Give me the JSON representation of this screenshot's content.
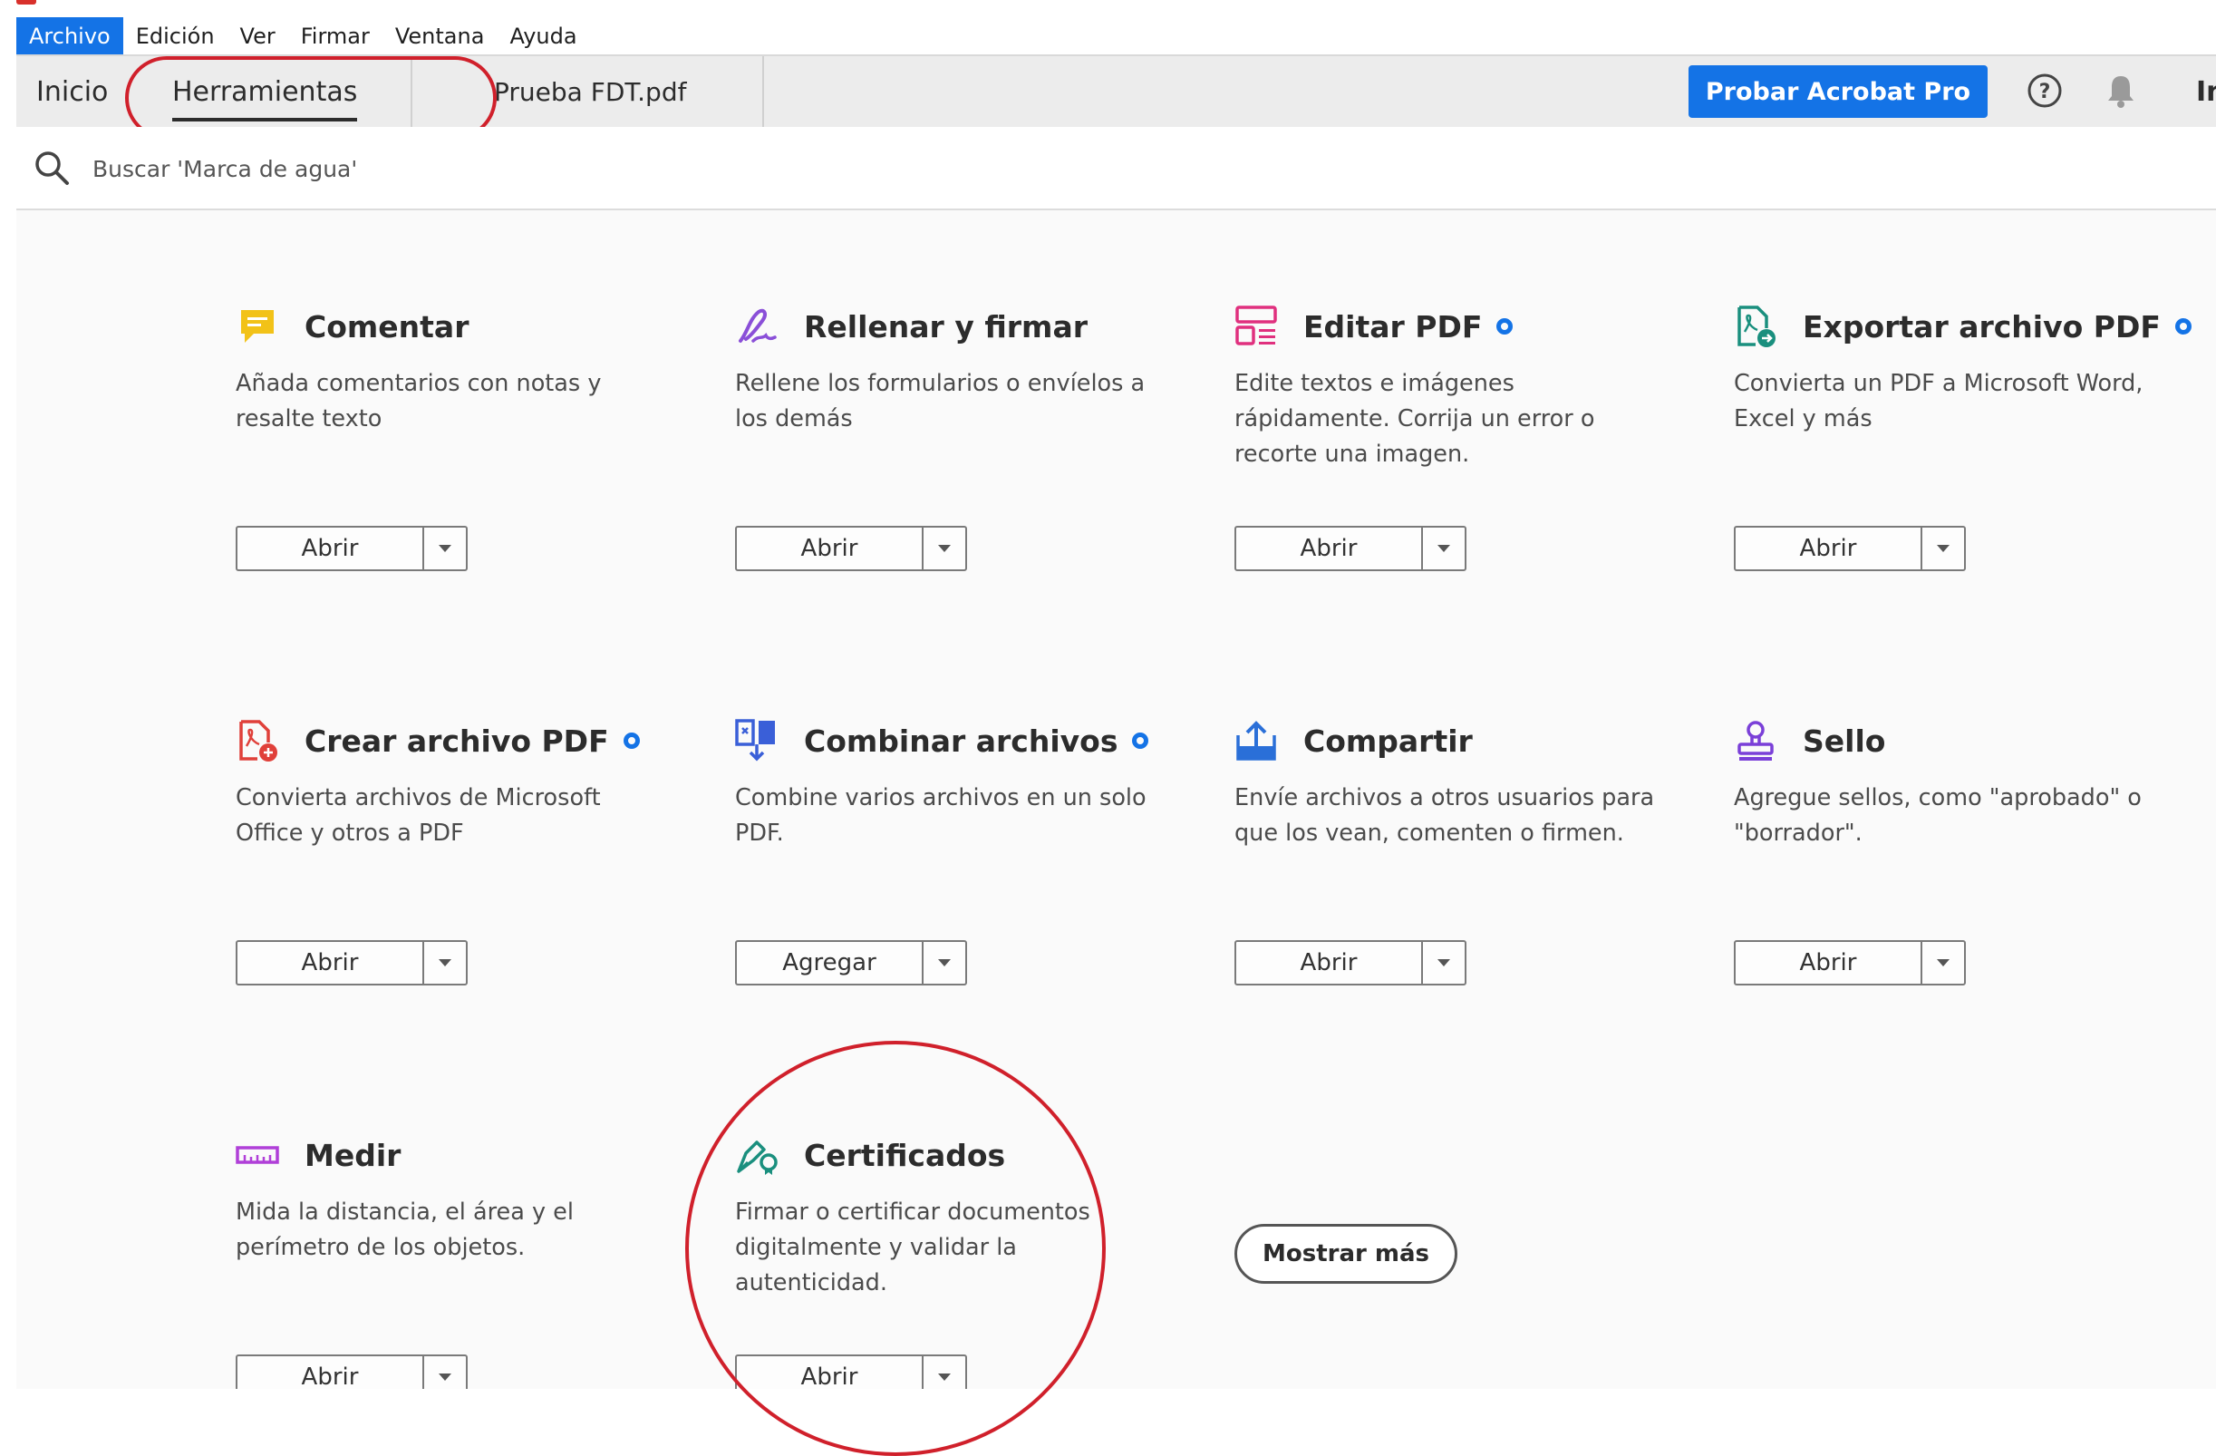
{
  "menu": [
    "Archivo",
    "Edición",
    "Ver",
    "Firmar",
    "Ventana",
    "Ayuda"
  ],
  "tabs": {
    "home": "Inicio",
    "tools": "Herramientas",
    "file": "Prueba FDT.pdf",
    "signin": "Ini"
  },
  "header": {
    "pro_button": "Probar Acrobat Pro"
  },
  "search": {
    "placeholder": "Buscar 'Marca de agua'"
  },
  "tools": [
    {
      "title": "Comentar",
      "desc": "Añada comentarios con notas y resalte texto",
      "button": "Abrir",
      "pro": false,
      "icon": "comment-icon"
    },
    {
      "title": "Rellenar y firmar",
      "desc": "Rellene los formularios o envíelos a los demás",
      "button": "Abrir",
      "pro": false,
      "icon": "fill-sign-icon"
    },
    {
      "title": "Editar PDF",
      "desc": "Edite textos e imágenes rápidamente. Corrija un error o recorte una imagen.",
      "button": "Abrir",
      "pro": true,
      "icon": "edit-pdf-icon"
    },
    {
      "title": "Exportar archivo PDF",
      "desc": "Convierta un PDF a Microsoft Word, Excel y más",
      "button": "Abrir",
      "pro": true,
      "icon": "export-pdf-icon"
    },
    {
      "title": "Crear archivo PDF",
      "desc": "Convierta archivos de Microsoft Office y otros a PDF",
      "button": "Abrir",
      "pro": true,
      "icon": "create-pdf-icon"
    },
    {
      "title": "Combinar archivos",
      "desc": "Combine varios archivos en un solo PDF.",
      "button": "Agregar",
      "pro": true,
      "icon": "combine-files-icon"
    },
    {
      "title": "Compartir",
      "desc": "Envíe archivos a otros usuarios para que los vean, comenten o firmen.",
      "button": "Abrir",
      "pro": false,
      "icon": "share-icon"
    },
    {
      "title": "Sello",
      "desc": "Agregue sellos, como \"aprobado\" o \"borrador\".",
      "button": "Abrir",
      "pro": false,
      "icon": "stamp-icon"
    },
    {
      "title": "Medir",
      "desc": "Mida la distancia, el área y el perímetro de los objetos.",
      "button": "Abrir",
      "pro": false,
      "icon": "measure-icon"
    },
    {
      "title": "Certificados",
      "desc": "Firmar o certificar documentos digitalmente y validar la autenticidad.",
      "button": "Abrir",
      "pro": false,
      "icon": "certificates-icon"
    }
  ],
  "show_more": "Mostrar más",
  "colors": {
    "accent": "#1473e6",
    "highlight": "#d0202b"
  }
}
